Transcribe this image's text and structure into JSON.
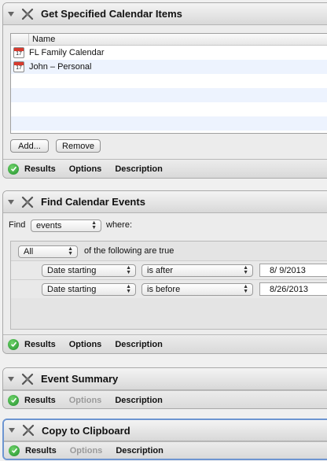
{
  "actions": [
    {
      "title": "Get Specified Calendar Items",
      "table": {
        "column_header": "Name",
        "rows": [
          {
            "name": "FL Family Calendar"
          },
          {
            "name": "John – Personal"
          }
        ]
      },
      "buttons": {
        "add": "Add...",
        "remove": "Remove"
      },
      "footer": {
        "results": "Results",
        "options": "Options",
        "description": "Description"
      }
    },
    {
      "title": "Find Calendar Events",
      "find_label": "Find",
      "find_value": "events",
      "where_label": "where:",
      "match_value": "All",
      "match_suffix": "of the following are true",
      "rules": [
        {
          "field": "Date starting",
          "operator": "is after",
          "date": "8/  9/2013"
        },
        {
          "field": "Date starting",
          "operator": "is before",
          "date": "8/26/2013"
        }
      ],
      "footer": {
        "results": "Results",
        "options": "Options",
        "description": "Description"
      }
    },
    {
      "title": "Event Summary",
      "footer": {
        "results": "Results",
        "options": "Options",
        "description": "Description"
      }
    },
    {
      "title": "Copy to Clipboard",
      "footer": {
        "results": "Results",
        "options": "Options",
        "description": "Description"
      }
    }
  ],
  "calendar_icon_day": "17"
}
